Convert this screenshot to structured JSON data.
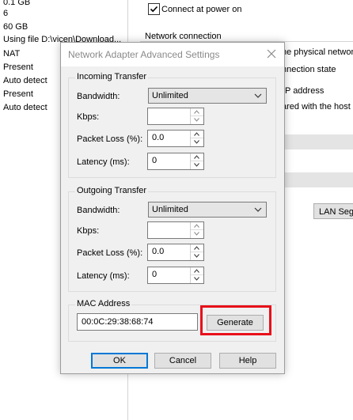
{
  "background": {
    "list_items": [
      "0.1 GB",
      "6",
      "60 GB",
      "Using file D:\\vicen\\Download...",
      "NAT",
      "Present",
      "Auto detect",
      "Present",
      "Auto detect"
    ],
    "connect_at_power_on": "Connect at power on",
    "network_connection": "Network connection",
    "physical_network": "he physical networ",
    "connection_state": "nnection state",
    "p_address": "P address",
    "shared_with_host": "ared with the host",
    "lan_segments_button": "LAN Segm"
  },
  "dialog": {
    "title": "Network Adapter Advanced Settings",
    "incoming": {
      "legend": "Incoming Transfer",
      "bandwidth_label": "Bandwidth:",
      "bandwidth_value": "Unlimited",
      "kbps_label": "Kbps:",
      "kbps_value": "",
      "packet_loss_label": "Packet Loss (%):",
      "packet_loss_value": "0.0",
      "latency_label": "Latency (ms):",
      "latency_value": "0"
    },
    "outgoing": {
      "legend": "Outgoing Transfer",
      "bandwidth_label": "Bandwidth:",
      "bandwidth_value": "Unlimited",
      "kbps_label": "Kbps:",
      "kbps_value": "",
      "packet_loss_label": "Packet Loss (%):",
      "packet_loss_value": "0.0",
      "latency_label": "Latency (ms):",
      "latency_value": "0"
    },
    "mac": {
      "legend": "MAC Address",
      "value": "00:0C:29:38:68:74",
      "generate_label": "Generate"
    },
    "buttons": {
      "ok": "OK",
      "cancel": "Cancel",
      "help": "Help"
    }
  },
  "icons": {
    "close": "close-icon",
    "dropdown": "chevron-down-icon",
    "spin_up": "spin-up-icon",
    "spin_down": "spin-down-icon",
    "checkmark": "checkmark-icon"
  },
  "colors": {
    "highlight": "#e8101a",
    "default_button_border": "#0078d7"
  }
}
